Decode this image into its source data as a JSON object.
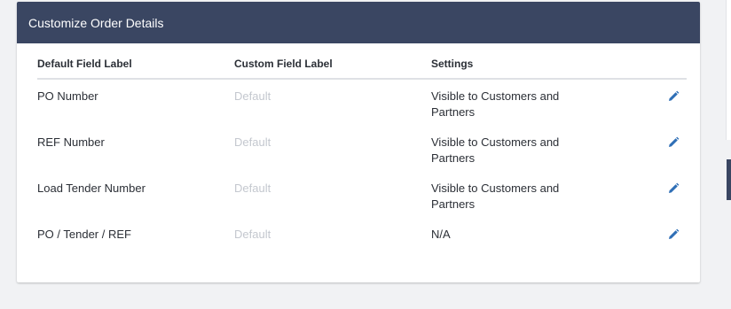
{
  "card": {
    "title": "Customize Order Details"
  },
  "table": {
    "headers": {
      "default_label": "Default Field Label",
      "custom_label": "Custom Field Label",
      "settings": "Settings"
    },
    "rows": [
      {
        "default_label": "PO Number",
        "custom_label": "Default",
        "settings": "Visible to Customers and Partners",
        "action_icon": "pencil-icon"
      },
      {
        "default_label": "REF Number",
        "custom_label": "Default",
        "settings": "Visible to Customers and Partners",
        "action_icon": "pencil-icon"
      },
      {
        "default_label": "Load Tender Number",
        "custom_label": "Default",
        "settings": "Visible to Customers and Partners",
        "action_icon": "pencil-icon"
      },
      {
        "default_label": "PO / Tender / REF",
        "custom_label": "Default",
        "settings": "N/A",
        "action_icon": "pencil-icon"
      }
    ]
  },
  "colors": {
    "header_bg": "#3a4662",
    "placeholder_text": "#c4c8cf",
    "edit_icon": "#2f6fb6"
  }
}
